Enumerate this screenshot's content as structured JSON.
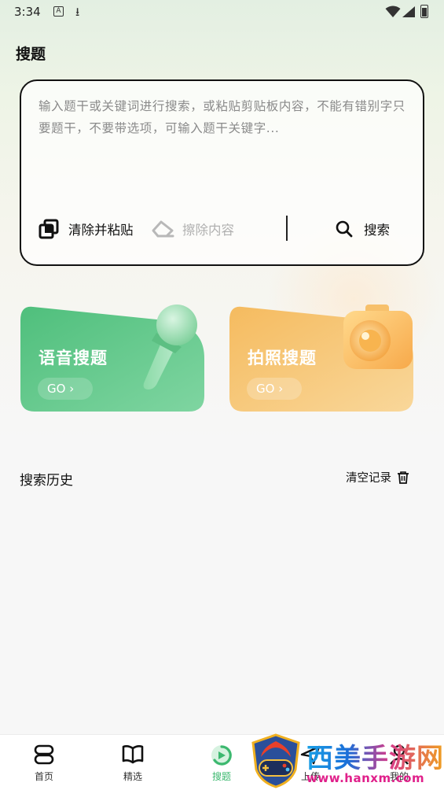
{
  "status_bar": {
    "time": "3:34",
    "a_badge": "A"
  },
  "page_title": "搜题",
  "search": {
    "placeholder": "输入题干或关键词进行搜索，或粘贴剪贴板内容，不能有错别字只要题干，不要带选项，可输入题干关键字...",
    "paste_label": "清除并粘贴",
    "erase_label": "擦除内容",
    "search_label": "搜索"
  },
  "cards": {
    "voice": {
      "title": "语音搜题",
      "go": "GO",
      "color": "#5fc48a"
    },
    "photo": {
      "title": "拍照搜题",
      "go": "GO",
      "color": "#f4c36d"
    }
  },
  "history": {
    "title": "搜索历史",
    "clear_label": "清空记录"
  },
  "nav": {
    "items": [
      {
        "label": "首页",
        "icon": "home-icon"
      },
      {
        "label": "精选",
        "icon": "book-icon"
      },
      {
        "label": "搜题",
        "icon": "search-tab-icon"
      },
      {
        "label": "上传",
        "icon": "upload-icon"
      },
      {
        "label": "我的",
        "icon": "profile-icon"
      }
    ],
    "active_color": "#3cb86f"
  },
  "watermark": {
    "title": "西美手游网",
    "url": "www.hanxm.com"
  }
}
